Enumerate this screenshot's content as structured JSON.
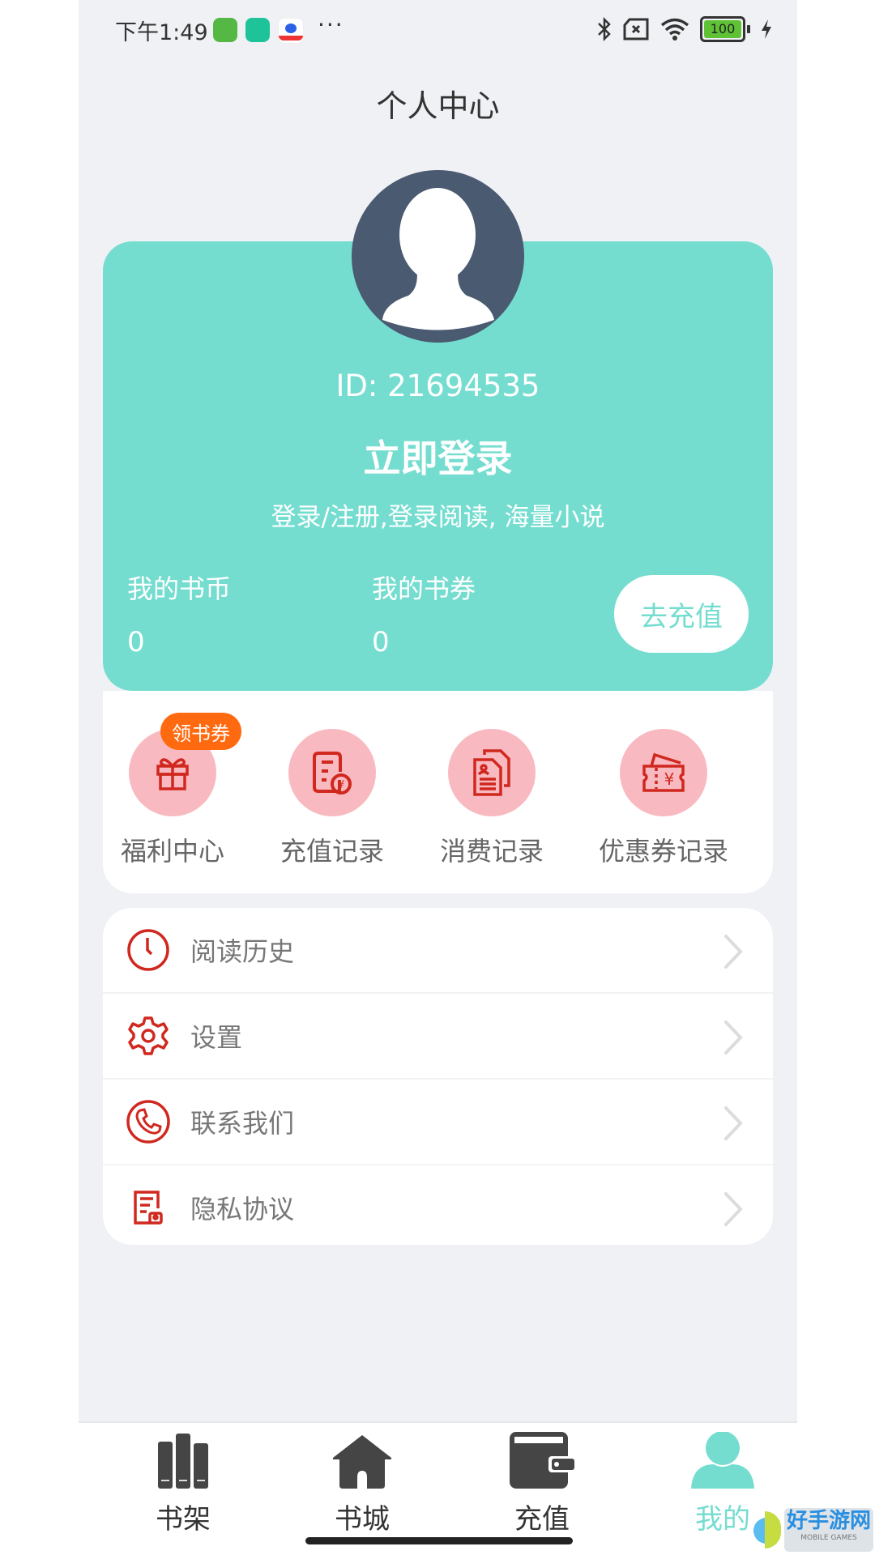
{
  "status_bar": {
    "time": "下午1:49",
    "more": "···",
    "battery": "100",
    "notification_icons": [
      "android-app-icon",
      "security-shield-icon",
      "baidu-icon"
    ],
    "system_icons": [
      "bluetooth-icon",
      "no-sim-icon",
      "wifi-icon",
      "battery-icon",
      "charging-icon"
    ]
  },
  "header": {
    "title": "个人中心"
  },
  "profile": {
    "id_text": "ID: 21694535",
    "login_label": "立即登录",
    "subtitle": "登录/注册,登录阅读, 海量小说",
    "coins_label": "我的书币",
    "coins_value": "0",
    "vouchers_label": "我的书券",
    "vouchers_value": "0",
    "recharge_button": "去充值"
  },
  "quick_actions": [
    {
      "label": "福利中心",
      "icon": "gift-icon",
      "badge": "领书券"
    },
    {
      "label": "充值记录",
      "icon": "recharge-record-icon"
    },
    {
      "label": "消费记录",
      "icon": "documents-icon"
    },
    {
      "label": "优惠券记录",
      "icon": "coupon-icon"
    }
  ],
  "menu": [
    {
      "label": "阅读历史",
      "icon": "clock-icon"
    },
    {
      "label": "设置",
      "icon": "gear-icon"
    },
    {
      "label": "联系我们",
      "icon": "phone-icon"
    },
    {
      "label": "隐私协议",
      "icon": "privacy-document-icon"
    }
  ],
  "tabs": [
    {
      "label": "书架",
      "icon": "bookshelf-icon",
      "active": false
    },
    {
      "label": "书城",
      "icon": "home-icon",
      "active": false
    },
    {
      "label": "充值",
      "icon": "wallet-icon",
      "active": false
    },
    {
      "label": "我的",
      "icon": "user-icon",
      "active": true
    }
  ],
  "watermark": {
    "title": "好手游网",
    "subtitle": "MOBILE GAMES"
  },
  "colors": {
    "accent": "#75ddd0",
    "icon_red": "#d0281f",
    "icon_bg": "#f9b9c0",
    "badge": "#ff6a10",
    "tab_inactive": "#454545"
  }
}
